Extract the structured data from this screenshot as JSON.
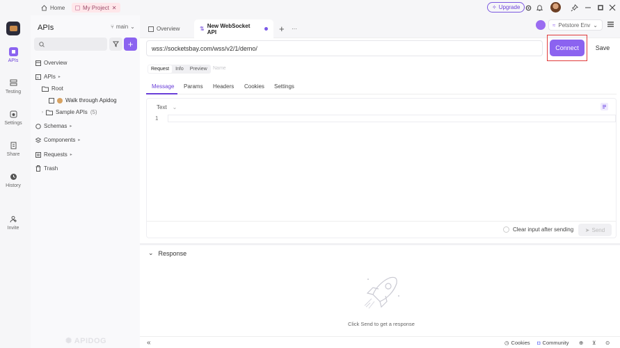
{
  "topbar": {
    "home_label": "Home",
    "project_label": "My Project",
    "upgrade_label": "Upgrade"
  },
  "rail": {
    "items": [
      {
        "label": "APIs",
        "icon": "apis-icon"
      },
      {
        "label": "Testing",
        "icon": "testing-icon"
      },
      {
        "label": "Settings",
        "icon": "settings-icon"
      },
      {
        "label": "Share",
        "icon": "share-icon"
      },
      {
        "label": "History",
        "icon": "history-icon"
      },
      {
        "label": "Invite",
        "icon": "invite-icon"
      }
    ]
  },
  "sidebar": {
    "title": "APIs",
    "branch": "main",
    "search_placeholder": "",
    "tree": [
      {
        "label": "Overview"
      },
      {
        "label": "APIs"
      },
      {
        "label": "Root"
      },
      {
        "label": "Walk through Apidog"
      },
      {
        "label": "Sample APIs",
        "count": "(5)"
      },
      {
        "label": "Schemas"
      },
      {
        "label": "Components"
      },
      {
        "label": "Requests"
      },
      {
        "label": "Trash"
      }
    ],
    "logo_text": "APIDOG"
  },
  "tabs": {
    "overview": "Overview",
    "active": "New WebSocket API",
    "more": "···"
  },
  "env": {
    "label": "Petstore Env"
  },
  "request": {
    "url": "wss://socketsbay.com/wss/v2/1/demo/",
    "connect_label": "Connect",
    "save_label": "Save",
    "modes": [
      "Request",
      "Info",
      "Preview"
    ],
    "name_placeholder": "Name",
    "sub_tabs": [
      "Message",
      "Params",
      "Headers",
      "Cookies",
      "Settings"
    ],
    "editor_type": "Text",
    "line_number": "1",
    "clear_label": "Clear input after sending",
    "send_label": "Send"
  },
  "response": {
    "title": "Response",
    "empty_text": "Click Send to get a response"
  },
  "statusbar": {
    "collapse": "«",
    "cookies": "Cookies",
    "community": "Community"
  },
  "colors": {
    "accent": "#8b63f0",
    "highlight_box": "#e03a3a"
  }
}
